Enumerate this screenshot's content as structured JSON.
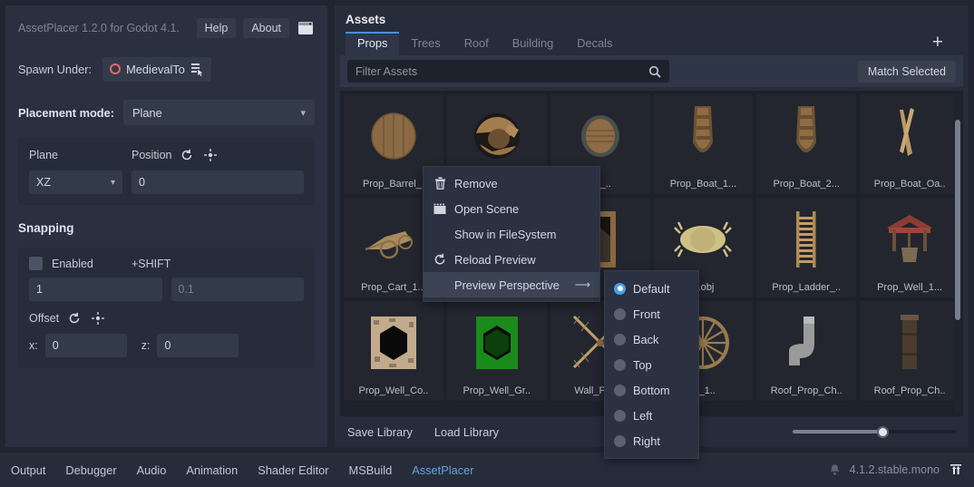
{
  "left": {
    "plugin_title": "AssetPlacer 1.2.0 for Godot 4.1.",
    "help_label": "Help",
    "about_label": "About",
    "window_icon": "window-icon",
    "spawn_under_label": "Spawn Under:",
    "spawn_under_value": "MedievalTo",
    "spawn_pick_icon": "node-pick-icon",
    "placement_mode_label": "Placement mode:",
    "placement_mode_value": "Plane",
    "plane_label": "Plane",
    "plane_value": "XZ",
    "position_label": "Position",
    "position_value": "0",
    "reset_icon": "reset-icon",
    "target_icon": "crosshair-icon",
    "snapping_title": "Snapping",
    "enabled_label": "Enabled",
    "shift_label": "+SHIFT",
    "snap_step_value": "1",
    "snap_shift_placeholder": "0.1",
    "offset_label": "Offset",
    "offset_x_label": "x:",
    "offset_x_value": "0",
    "offset_z_label": "z:",
    "offset_z_value": "0"
  },
  "assets": {
    "panel_title": "Assets",
    "tabs": [
      {
        "label": "Props",
        "active": true
      },
      {
        "label": "Trees",
        "active": false
      },
      {
        "label": "Roof",
        "active": false
      },
      {
        "label": "Building",
        "active": false
      },
      {
        "label": "Decals",
        "active": false
      }
    ],
    "add_tab_icon": "plus-icon",
    "filter_placeholder": "Filter Assets",
    "search_icon": "search-icon",
    "match_selected_label": "Match Selected",
    "items": [
      {
        "label": "Prop_Barrel_.",
        "thumb": "barrel"
      },
      {
        "label": "",
        "thumb": "barrel-open"
      },
      {
        "label": "rel_..",
        "thumb": "barrel-small"
      },
      {
        "label": "Prop_Boat_1...",
        "thumb": "boat"
      },
      {
        "label": "Prop_Boat_2...",
        "thumb": "boat"
      },
      {
        "label": "Prop_Boat_Oa..",
        "thumb": "oars"
      },
      {
        "label": "Prop_Cart_1...",
        "thumb": "cart"
      },
      {
        "label": "",
        "thumb": "crate"
      },
      {
        "label": "",
        "thumb": "door"
      },
      {
        "label": "1.obj",
        "thumb": "haybale"
      },
      {
        "label": "Prop_Ladder_..",
        "thumb": "ladder"
      },
      {
        "label": "Prop_Well_1...",
        "thumb": "well"
      },
      {
        "label": "Prop_Well_Co..",
        "thumb": "well-cover-stone"
      },
      {
        "label": "Prop_Well_Gr..",
        "thumb": "well-cover-grass"
      },
      {
        "label": "Wall_Prop_",
        "thumb": "windmill"
      },
      {
        "label": "el_1..",
        "thumb": "wheel"
      },
      {
        "label": "Roof_Prop_Ch..",
        "thumb": "chimney-pipe"
      },
      {
        "label": "Roof_Prop_Ch..",
        "thumb": "chimney"
      }
    ],
    "save_library_label": "Save Library",
    "load_library_label": "Load Library",
    "zoom_slider_percent": 55
  },
  "context_menu": {
    "items": [
      {
        "label": "Remove",
        "icon": "trash-icon",
        "highlighted": false,
        "submenu": false
      },
      {
        "label": "Open Scene",
        "icon": "scene-icon",
        "highlighted": false,
        "submenu": false
      },
      {
        "label": "Show in FileSystem",
        "icon": "",
        "highlighted": false,
        "submenu": false
      },
      {
        "label": "Reload Preview",
        "icon": "reload-icon",
        "highlighted": false,
        "submenu": false
      },
      {
        "label": "Preview Perspective",
        "icon": "",
        "highlighted": true,
        "submenu": true
      }
    ],
    "submenu_arrow_icon": "arrow-right-icon",
    "submenu_items": [
      {
        "label": "Default",
        "selected": true
      },
      {
        "label": "Front",
        "selected": false
      },
      {
        "label": "Back",
        "selected": false
      },
      {
        "label": "Top",
        "selected": false
      },
      {
        "label": "Bottom",
        "selected": false
      },
      {
        "label": "Left",
        "selected": false
      },
      {
        "label": "Right",
        "selected": false
      }
    ]
  },
  "statusbar": {
    "items": [
      {
        "label": "Output",
        "active": false
      },
      {
        "label": "Debugger",
        "active": false
      },
      {
        "label": "Audio",
        "active": false
      },
      {
        "label": "Animation",
        "active": false
      },
      {
        "label": "Shader Editor",
        "active": false
      },
      {
        "label": "MSBuild",
        "active": false
      },
      {
        "label": "AssetPlacer",
        "active": true
      }
    ],
    "bell_icon": "bell-icon",
    "version": "4.1.2.stable.mono",
    "update_icon": "arrows-up-icon"
  },
  "colors": {
    "accent": "#4a90d9",
    "panel": "#2a3040",
    "panel_dark": "#262c3a",
    "grid_bg": "#1d212b",
    "link": "#60a5e0",
    "node_red": "#e06a6a"
  }
}
